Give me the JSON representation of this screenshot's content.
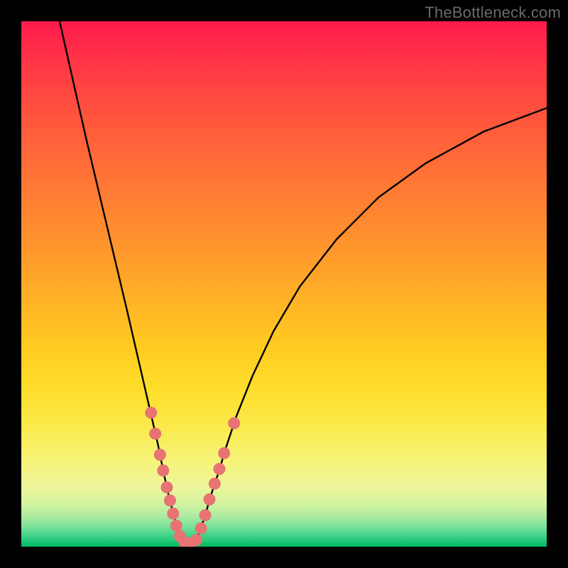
{
  "watermark": "TheBottleneck.com",
  "colors": {
    "frame": "#000000",
    "curve": "#000000",
    "marker_fill": "#e77373",
    "marker_stroke": "#d85e5e"
  },
  "chart_data": {
    "type": "line",
    "title": "",
    "xlabel": "",
    "ylabel": "",
    "xlim": [
      0,
      100
    ],
    "ylim": [
      0,
      100
    ],
    "notes": "V-shaped bottleneck curve on rainbow gradient background; vertex sits on the green band (~y=0). Pink markers cluster along both branches near the vertex.",
    "series": [
      {
        "name": "left-branch",
        "x": [
          7.3,
          10,
          12.5,
          15,
          17.5,
          20,
          21.5,
          23,
          24.5,
          26,
          27,
          28,
          29,
          30,
          30.7
        ],
        "y": [
          100,
          88,
          77,
          66.5,
          56,
          45.5,
          39,
          32.5,
          26,
          19.5,
          14.5,
          10,
          6,
          2.5,
          0.7
        ]
      },
      {
        "name": "right-branch",
        "x": [
          33.1,
          34,
          35,
          36,
          37.5,
          39,
          41,
          44,
          48,
          53,
          60,
          68,
          77,
          88,
          100
        ],
        "y": [
          0.7,
          3,
          6,
          9.5,
          14,
          19,
          25,
          32.5,
          41,
          49.5,
          58.5,
          66.5,
          73,
          79,
          83.5
        ]
      }
    ],
    "markers": {
      "name": "data-points",
      "points": [
        {
          "x": 24.7,
          "y": 25.5
        },
        {
          "x": 25.5,
          "y": 21.5
        },
        {
          "x": 26.4,
          "y": 17.5
        },
        {
          "x": 27.0,
          "y": 14.5
        },
        {
          "x": 27.7,
          "y": 11.3
        },
        {
          "x": 28.3,
          "y": 8.8
        },
        {
          "x": 28.9,
          "y": 6.3
        },
        {
          "x": 29.5,
          "y": 4.0
        },
        {
          "x": 30.2,
          "y": 2.0
        },
        {
          "x": 31.1,
          "y": 0.8
        },
        {
          "x": 32.3,
          "y": 0.7
        },
        {
          "x": 33.3,
          "y": 1.3
        },
        {
          "x": 34.2,
          "y": 3.5
        },
        {
          "x": 35.0,
          "y": 6.0
        },
        {
          "x": 35.8,
          "y": 9.0
        },
        {
          "x": 36.8,
          "y": 12.0
        },
        {
          "x": 37.7,
          "y": 14.8
        },
        {
          "x": 38.6,
          "y": 17.8
        },
        {
          "x": 40.5,
          "y": 23.5
        }
      ]
    }
  }
}
